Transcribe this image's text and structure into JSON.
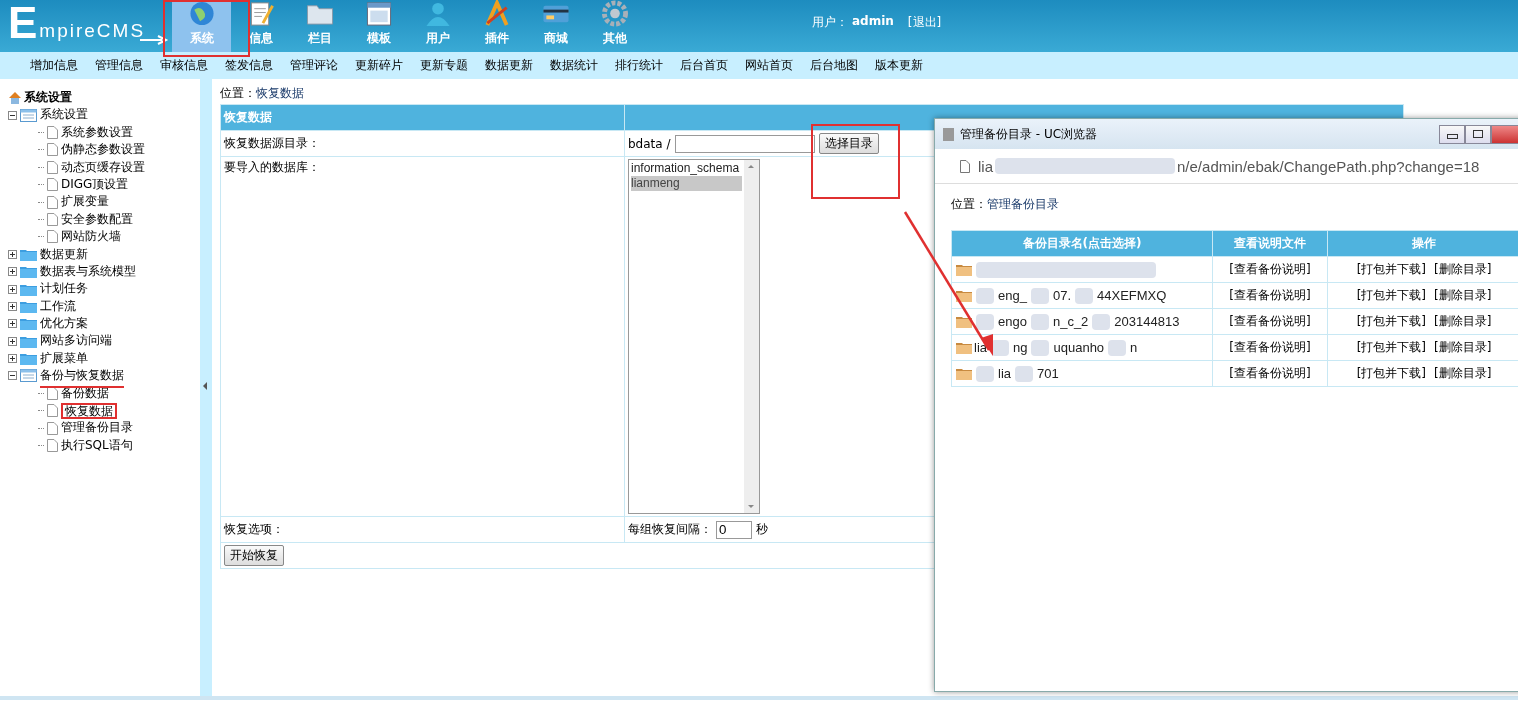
{
  "header": {
    "logo_initial": "E",
    "logo_rest": "mpireCMS",
    "user_label": "用户：",
    "user": "admin",
    "logout": "[退出]"
  },
  "top_tabs": [
    {
      "label": "系统",
      "selected": true
    },
    {
      "label": "信息",
      "selected": false
    },
    {
      "label": "栏目",
      "selected": false
    },
    {
      "label": "模板",
      "selected": false
    },
    {
      "label": "用户",
      "selected": false
    },
    {
      "label": "插件",
      "selected": false
    },
    {
      "label": "商城",
      "selected": false
    },
    {
      "label": "其他",
      "selected": false
    }
  ],
  "menu": [
    "增加信息",
    "管理信息",
    "审核信息",
    "签发信息",
    "管理评论",
    "更新碎片",
    "更新专题",
    "数据更新",
    "数据统计",
    "排行统计",
    "后台首页",
    "网站首页",
    "后台地图",
    "版本更新"
  ],
  "sidebar": {
    "title": "系统设置",
    "tree": [
      {
        "label": "系统设置",
        "expanded": true,
        "children": [
          {
            "label": "系统参数设置"
          },
          {
            "label": "伪静态参数设置"
          },
          {
            "label": "动态页缓存设置"
          },
          {
            "label": "DIGG顶设置"
          },
          {
            "label": "扩展变量"
          },
          {
            "label": "安全参数配置"
          },
          {
            "label": "网站防火墙"
          }
        ]
      },
      {
        "label": "数据更新",
        "expanded": false
      },
      {
        "label": "数据表与系统模型",
        "expanded": false
      },
      {
        "label": "计划任务",
        "expanded": false
      },
      {
        "label": "工作流",
        "expanded": false
      },
      {
        "label": "优化方案",
        "expanded": false
      },
      {
        "label": "网站多访问端",
        "expanded": false
      },
      {
        "label": "扩展菜单",
        "expanded": false
      },
      {
        "label": "备份与恢复数据",
        "expanded": true,
        "children": [
          {
            "label": "备份数据"
          },
          {
            "label": "恢复数据"
          },
          {
            "label": "管理备份目录"
          },
          {
            "label": "执行SQL语句"
          }
        ]
      }
    ]
  },
  "main": {
    "location_label": "位置：",
    "location": "恢复数据",
    "form_title": "恢复数据",
    "source_label": "恢复数据源目录：",
    "source_prefix": "bdata /",
    "choose_button": "选择目录",
    "db_label": "要导入的数据库：",
    "databases": [
      {
        "name": "information_schema",
        "selected": false
      },
      {
        "name": "lianmeng",
        "selected": true
      }
    ],
    "options_label": "恢复选项：",
    "interval_label": "每组恢复间隔：",
    "interval_value": "0",
    "interval_unit": "秒",
    "start_button": "开始恢复"
  },
  "popup": {
    "title": "管理备份目录 - UC浏览器",
    "url_parts": [
      "lia",
      "n/e/admin/ebak/ChangePath.php?change=18"
    ],
    "location_label": "位置：",
    "location": "管理备份目录",
    "columns": [
      "备份目录名(点击选择)",
      "查看说明文件",
      "操作"
    ],
    "rows": [
      {
        "name_parts": [],
        "readme": "[查看备份说明]",
        "pack": "[打包并下载]",
        "delete": "[删除目录]"
      },
      {
        "name_parts": [
          "eng_",
          "07.",
          "44XEFMXQ"
        ],
        "readme": "[查看备份说明]",
        "pack": "[打包并下载]",
        "delete": "[删除目录]"
      },
      {
        "name_parts": [
          "engo",
          "n_c_2",
          "203144813"
        ],
        "readme": "[查看备份说明]",
        "pack": "[打包并下载]",
        "delete": "[删除目录]"
      },
      {
        "name_parts": [
          "lia",
          "ng",
          "uquanho",
          "n"
        ],
        "readme": "[查看备份说明]",
        "pack": "[打包并下载]",
        "delete": "[删除目录]"
      },
      {
        "name_parts": [
          "lia",
          "701"
        ],
        "readme": "[查看备份说明]",
        "pack": "[打包并下载]",
        "delete": "[删除目录]"
      }
    ]
  }
}
